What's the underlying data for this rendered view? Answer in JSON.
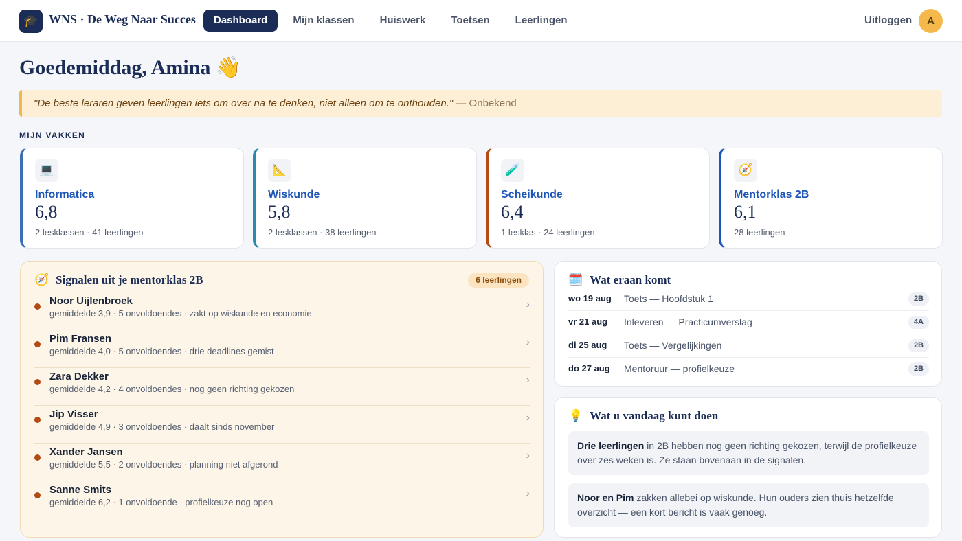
{
  "header": {
    "logo_icon": "graduation-cap-icon",
    "brand": "WNS · De Weg Naar Succes",
    "nav": [
      {
        "label": "Dashboard",
        "active": true
      },
      {
        "label": "Mijn klassen",
        "active": false
      },
      {
        "label": "Huiswerk",
        "active": false
      },
      {
        "label": "Toetsen",
        "active": false
      },
      {
        "label": "Leerlingen",
        "active": false
      }
    ],
    "logout": "Uitloggen",
    "avatar_initial": "A"
  },
  "greeting": "Goedemiddag, Amina 👋",
  "quote": {
    "text": "\"De beste leraren geven leerlingen iets om over na te denken, niet alleen om te onthouden.\"",
    "author": " — Onbekend"
  },
  "subjects_label": "MIJN VAKKEN",
  "subjects": [
    {
      "icon": "💻",
      "icon_name": "laptop-icon",
      "name": "Informatica",
      "grade": "6,8",
      "meta": "2 lesklassen · 41 leerlingen",
      "accent": "#3b6fb6"
    },
    {
      "icon": "📐",
      "icon_name": "ruler-icon",
      "name": "Wiskunde",
      "grade": "5,8",
      "meta": "2 lesklassen · 38 leerlingen",
      "accent": "#2b8aa8"
    },
    {
      "icon": "🧪",
      "icon_name": "test-tube-icon",
      "name": "Scheikunde",
      "grade": "6,4",
      "meta": "1 lesklas · 24 leerlingen",
      "accent": "#b44a16"
    },
    {
      "icon": "🧭",
      "icon_name": "compass-icon",
      "name": "Mentorklas 2B",
      "grade": "6,1",
      "meta": "28 leerlingen",
      "accent": "#1e56b8"
    }
  ],
  "signals": {
    "icon": "🧭",
    "title": "Signalen uit je mentorklas 2B",
    "count": "6 leerlingen",
    "students": [
      {
        "name": "Noor Uijlenbroek",
        "detail": "gemiddelde 3,9 · 5 onvoldoendes · zakt op wiskunde en economie"
      },
      {
        "name": "Pim Fransen",
        "detail": "gemiddelde 4,0 · 5 onvoldoendes · drie deadlines gemist"
      },
      {
        "name": "Zara Dekker",
        "detail": "gemiddelde 4,2 · 4 onvoldoendes · nog geen richting gekozen"
      },
      {
        "name": "Jip Visser",
        "detail": "gemiddelde 4,9 · 3 onvoldoendes · daalt sinds november"
      },
      {
        "name": "Xander Jansen",
        "detail": "gemiddelde 5,5 · 2 onvoldoendes · planning niet afgerond"
      },
      {
        "name": "Sanne Smits",
        "detail": "gemiddelde 6,2 · 1 onvoldoende · profielkeuze nog open"
      }
    ]
  },
  "upcoming": {
    "icon": "🗓️",
    "title": "Wat eraan komt",
    "items": [
      {
        "date": "wo 19 aug",
        "desc": "Toets — Hoofdstuk 1",
        "class": "2B"
      },
      {
        "date": "vr 21 aug",
        "desc": "Inleveren — Practicumverslag",
        "class": "4A"
      },
      {
        "date": "di 25 aug",
        "desc": "Toets — Vergelijkingen",
        "class": "2B"
      },
      {
        "date": "do 27 aug",
        "desc": "Mentoruur — profielkeuze",
        "class": "2B"
      }
    ]
  },
  "today": {
    "icon": "💡",
    "title": "Wat u vandaag kunt doen",
    "tips": [
      {
        "bold": "Drie leerlingen",
        "text": " in 2B hebben nog geen richting gekozen, terwijl de profielkeuze over zes weken is. Ze staan bovenaan in de signalen."
      },
      {
        "bold": "Noor en Pim",
        "text": " zakken allebei op wiskunde. Hun ouders zien thuis hetzelfde overzicht — een kort bericht is vaak genoeg."
      }
    ]
  }
}
